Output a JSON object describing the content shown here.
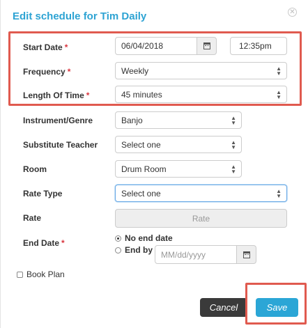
{
  "dialog": {
    "title": "Edit schedule for Tim Daily"
  },
  "form": {
    "start_date": {
      "label": "Start Date",
      "required": "*",
      "date": "06/04/2018",
      "time": "12:35pm"
    },
    "frequency": {
      "label": "Frequency",
      "required": "*",
      "value": "Weekly"
    },
    "length": {
      "label": "Length Of Time",
      "required": "*",
      "value": "45 minutes"
    },
    "instrument": {
      "label": "Instrument/Genre",
      "value": "Banjo"
    },
    "substitute": {
      "label": "Substitute Teacher",
      "value": "Select one"
    },
    "room": {
      "label": "Room",
      "value": "Drum Room"
    },
    "rate_type": {
      "label": "Rate Type",
      "value": "Select one"
    },
    "rate": {
      "label": "Rate",
      "placeholder": "Rate"
    },
    "end_date": {
      "label": "End Date",
      "required": "*",
      "option_no_end": "No end date",
      "option_end_by": "End by",
      "end_by_placeholder": "MM/dd/yyyy"
    },
    "book_plan": {
      "label": "Book Plan"
    }
  },
  "buttons": {
    "cancel": "Cancel",
    "save": "Save"
  },
  "colors": {
    "title": "#2da3d3",
    "save": "#2ba6d6",
    "cancel": "#3a3a3a",
    "highlight": "#e05a4f",
    "required": "#d9363e"
  },
  "icons": {
    "close": "close-circle-icon",
    "calendar": "calendar-icon",
    "select": "chevron-updown-icon"
  }
}
